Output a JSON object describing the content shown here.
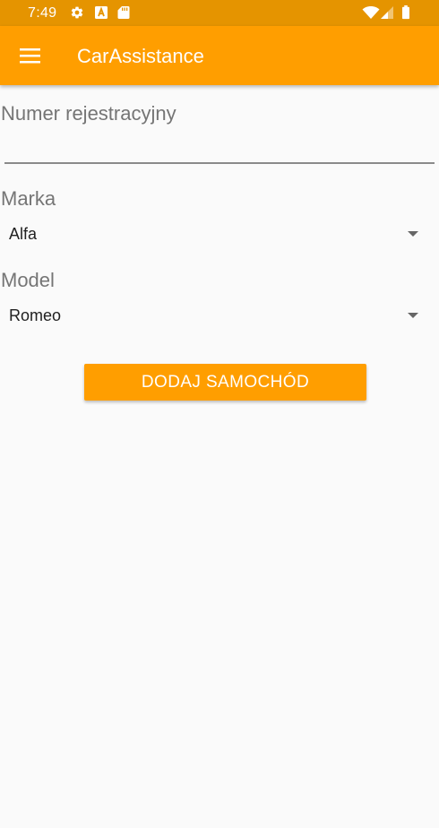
{
  "status_bar": {
    "time": "7:49",
    "icons": [
      "gear-icon",
      "a-icon",
      "sd-card-icon",
      "wifi-icon",
      "signal-icon",
      "battery-icon"
    ],
    "color": "#E59400"
  },
  "app_bar": {
    "title": "CarAssistance",
    "menu_icon": "hamburger-menu-icon",
    "color": "#FF9E00"
  },
  "form": {
    "registration": {
      "label": "Numer rejestracyjny",
      "value": ""
    },
    "brand": {
      "label": "Marka",
      "selected": "Alfa"
    },
    "model": {
      "label": "Model",
      "selected": "Romeo"
    },
    "submit_label": "DODAJ SAMOCHÓD"
  },
  "colors": {
    "accent": "#FF9E00",
    "status_bar": "#E59400",
    "background": "#FAFAFA",
    "label_text": "#757575"
  }
}
